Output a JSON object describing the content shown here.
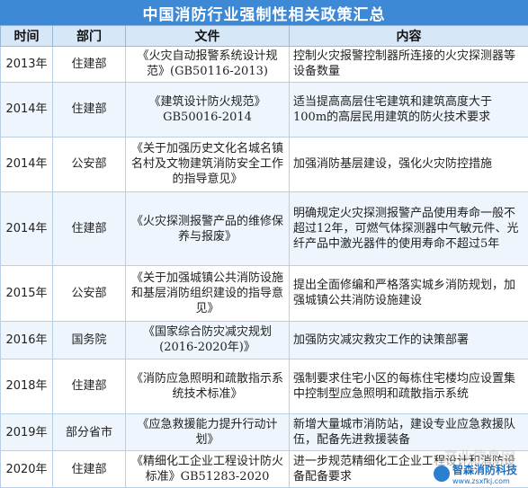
{
  "title": "中国消防行业强制性相关政策汇总",
  "columns": [
    "时间",
    "部门",
    "文件",
    "内容"
  ],
  "rows": [
    {
      "year": "2013年",
      "dept": "住建部",
      "doc": "《火灾自动报警系统设计规范》(GB50116-2013)",
      "content": "控制火灾报警控制器所连接的火灾探测器等设备数量"
    },
    {
      "year": "2014年",
      "dept": "住建部",
      "doc": "《建筑设计防火规范》GB50016-2014",
      "content": "适当提高高层住宅建筑和建筑高度大于100m的高层民用建筑的防火技术要求"
    },
    {
      "year": "2014年",
      "dept": "公安部",
      "doc": "《关于加强历史文化名城名镇名村及文物建筑消防安全工作的指导意见》",
      "content": "加强消防基层建设，强化火灾防控措施"
    },
    {
      "year": "2014年",
      "dept": "住建部",
      "doc": "《火灾探测报警产品的维修保养与报废》",
      "content": "明确规定火灾探测报警产品使用寿命一般不超过12年，可燃气体探测器中气敏元件、光纤产品中激光器件的使用寿命不超过5年"
    },
    {
      "year": "2015年",
      "dept": "公安部",
      "doc": "《关于加强城镇公共消防设施和基层消防组织建设的指导意见》",
      "content": "提出全面修编和严格落实城乡消防规划，加强城镇公共消防设施建设"
    },
    {
      "year": "2016年",
      "dept": "国务院",
      "doc": "《国家综合防灾减灾规划(2016-2020年)》",
      "content": "加强防灾减灾救灾工作的诀策部署"
    },
    {
      "year": "2018年",
      "dept": "住建部",
      "doc": "《消防应急照明和疏散指示系统技术标准》",
      "content": "强制要求住宅小区的每栋住宅楼均应设置集中控制型应急照明和疏散指示系统"
    },
    {
      "year": "2019年",
      "dept": "部分省市",
      "doc": "《应急救援能力提升行动计划》",
      "content": "新增大量城市消防站，建设专业应急救援队伍，配备先进救援装备"
    },
    {
      "year": "2020年",
      "dept": "住建部",
      "doc": "《精细化工企业工程设计防火标准》GB51283-2020",
      "content": "进一步规范精细化工企业工程设计和消防设备配备要求"
    }
  ],
  "watermark": {
    "site": "产业信息网",
    "brand": "智森消防科技",
    "url": "www.zsxfkj.com"
  },
  "colors": {
    "title_bg": "#3d89d6",
    "header_bg": "#d6e8f8",
    "alt_row_bg": "#eef5fc",
    "border": "#b9cfe6"
  }
}
